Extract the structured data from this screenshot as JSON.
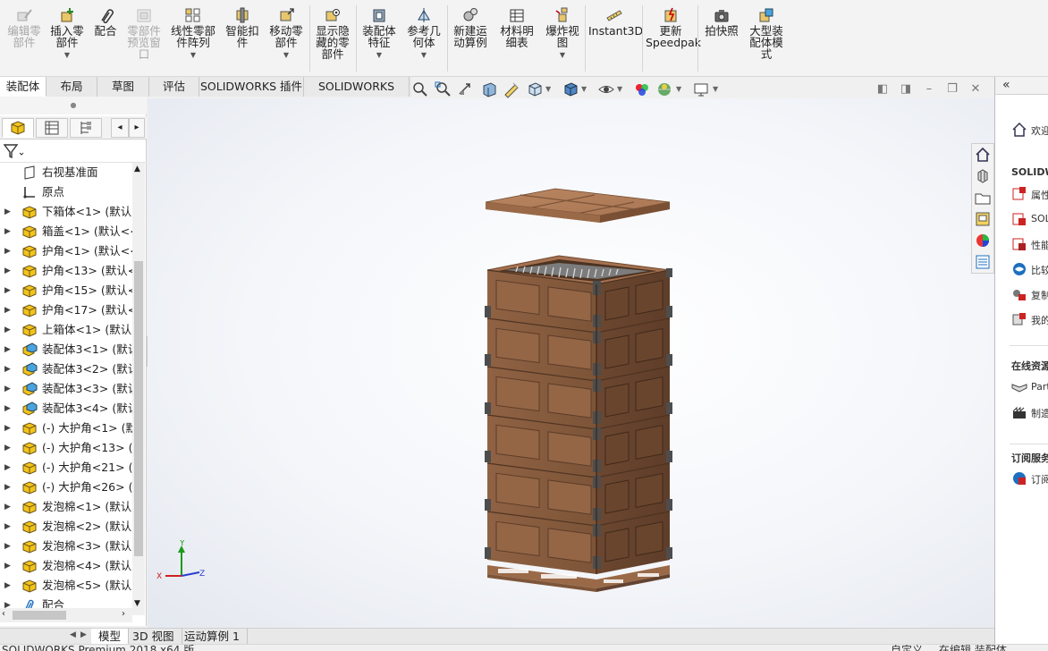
{
  "ribbon": {
    "buttons": [
      {
        "id": "edit-component",
        "label": "编辑零\n部件",
        "disabled": true,
        "dropdown": false
      },
      {
        "id": "insert-components",
        "label": "插入零\n部件",
        "disabled": false,
        "dropdown": true
      },
      {
        "id": "mate",
        "label": "配合",
        "disabled": false,
        "dropdown": false
      },
      {
        "id": "component-preview",
        "label": "零部件\n预览窗\n口",
        "disabled": true,
        "dropdown": false
      },
      {
        "id": "linear-pattern",
        "label": "线性零部\n件阵列",
        "disabled": false,
        "dropdown": true
      },
      {
        "id": "smart-fasteners",
        "label": "智能扣\n件",
        "disabled": false,
        "dropdown": false
      },
      {
        "id": "move-component",
        "label": "移动零\n部件",
        "disabled": false,
        "dropdown": true
      },
      {
        "id": "show-hidden",
        "label": "显示隐\n藏的零\n部件",
        "disabled": false,
        "dropdown": false
      },
      {
        "id": "assembly-features",
        "label": "装配体\n特征",
        "disabled": false,
        "dropdown": true
      },
      {
        "id": "reference-geometry",
        "label": "参考几\n何体",
        "disabled": false,
        "dropdown": true
      },
      {
        "id": "new-motion-study",
        "label": "新建运\n动算例",
        "disabled": false,
        "dropdown": false
      },
      {
        "id": "bill-of-materials",
        "label": "材料明\n细表",
        "disabled": false,
        "dropdown": false
      },
      {
        "id": "exploded-view",
        "label": "爆炸视\n图",
        "disabled": false,
        "dropdown": true
      },
      {
        "id": "instant3d",
        "label": "Instant3D",
        "disabled": false,
        "dropdown": false
      },
      {
        "id": "update-speedpak",
        "label": "更新\nSpeedpak",
        "disabled": false,
        "dropdown": false
      },
      {
        "id": "take-snapshot",
        "label": "拍快照",
        "disabled": false,
        "dropdown": false
      },
      {
        "id": "large-assembly-mode",
        "label": "大型装\n配体模\n式",
        "disabled": false,
        "dropdown": false
      }
    ]
  },
  "tabs": [
    "装配体",
    "布局",
    "草图",
    "评估",
    "SOLIDWORKS 插件",
    "SOLIDWORKS MBD"
  ],
  "active_tab": "装配体",
  "tree": {
    "items": [
      {
        "label": "右视基准面",
        "icon": "plane",
        "expandable": false
      },
      {
        "label": "原点",
        "icon": "origin",
        "expandable": false
      },
      {
        "label": "下箱体<1> (默认<",
        "icon": "part",
        "expandable": true
      },
      {
        "label": "箱盖<1> (默认<<",
        "icon": "part",
        "expandable": true
      },
      {
        "label": "护角<1> (默认<<",
        "icon": "part",
        "expandable": true
      },
      {
        "label": "护角<13> (默认<",
        "icon": "part",
        "expandable": true
      },
      {
        "label": "护角<15> (默认<",
        "icon": "part",
        "expandable": true
      },
      {
        "label": "护角<17> (默认<",
        "icon": "part",
        "expandable": true
      },
      {
        "label": "上箱体<1> (默认<",
        "icon": "part",
        "expandable": true
      },
      {
        "label": "装配体3<1> (默认",
        "icon": "assembly",
        "expandable": true
      },
      {
        "label": "装配体3<2> (默认",
        "icon": "assembly",
        "expandable": true
      },
      {
        "label": "装配体3<3> (默认",
        "icon": "assembly",
        "expandable": true
      },
      {
        "label": "装配体3<4> (默认",
        "icon": "assembly",
        "expandable": true
      },
      {
        "label": "(-) 大护角<1> (默",
        "icon": "part",
        "expandable": true
      },
      {
        "label": "(-) 大护角<13> (默",
        "icon": "part",
        "expandable": true
      },
      {
        "label": "(-) 大护角<21> (默",
        "icon": "part",
        "expandable": true
      },
      {
        "label": "(-) 大护角<26> (默",
        "icon": "part",
        "expandable": true
      },
      {
        "label": "发泡棉<1> (默认<",
        "icon": "part",
        "expandable": true
      },
      {
        "label": "发泡棉<2> (默认<",
        "icon": "part",
        "expandable": true
      },
      {
        "label": "发泡棉<3> (默认<",
        "icon": "part",
        "expandable": true
      },
      {
        "label": "发泡棉<4> (默认<",
        "icon": "part",
        "expandable": true
      },
      {
        "label": "发泡棉<5> (默认<",
        "icon": "part",
        "expandable": true
      },
      {
        "label": "配合",
        "icon": "mates",
        "expandable": true
      }
    ]
  },
  "bottom_tabs": [
    "模型",
    "3D 视图",
    "运动算例 1"
  ],
  "active_bottom_tab": "模型",
  "status_text": "SOLIDWORKS Premium 2018 x64 版",
  "status_right": [
    "自定义",
    "在编辑 装配体"
  ],
  "task_pane": {
    "welcome": "欢迎",
    "section_solidworks": "SOLIDW",
    "items_solidworks": [
      {
        "icon": "properties-icon",
        "label": "属性"
      },
      {
        "icon": "solidworks-rx-icon",
        "label": "SOL"
      },
      {
        "icon": "performance-icon",
        "label": "性能"
      },
      {
        "icon": "compare-icon",
        "label": "比较"
      },
      {
        "icon": "copy-settings-icon",
        "label": "复制"
      },
      {
        "icon": "my-products-icon",
        "label": "我的"
      }
    ],
    "section_online": "在线资源",
    "items_online": [
      {
        "icon": "partner-icon",
        "label": "Part"
      },
      {
        "icon": "manufacturing-icon",
        "label": "制造"
      }
    ],
    "section_subscription": "订阅服务",
    "items_subscription": [
      {
        "icon": "subscription-icon",
        "label": "订阅"
      }
    ]
  },
  "colors": {
    "wood": "#8a5e3f",
    "wood_light": "#b07b55",
    "wood_dark": "#6f4a31",
    "bracket": "#4d4d4d",
    "part_icon": "#f2c418",
    "assembly_icon": "#4aa3df",
    "accent_blue": "#1e6fbf"
  }
}
